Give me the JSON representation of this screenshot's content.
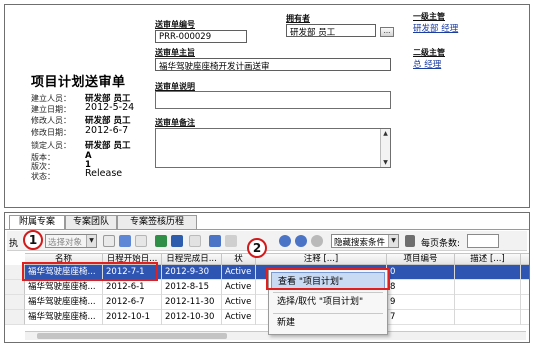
{
  "form": {
    "title": "项目计划送审单",
    "meta_rows": [
      {
        "label": "建立人员：",
        "value": "研发部 员工",
        "bold": true
      },
      {
        "label": "建立日期：",
        "value": "2012-5-24",
        "bold": false
      },
      {
        "label": "修改人员：",
        "value": "研发部 员工",
        "bold": true
      },
      {
        "label": "修改日期：",
        "value": "2012-6-7",
        "bold": false
      },
      {
        "label": "锁定人员：",
        "value": "研发部 员工",
        "bold": true
      },
      {
        "label": "版本：",
        "value": "A",
        "bold": true
      },
      {
        "label": "版次：",
        "value": "1",
        "bold": true
      },
      {
        "label": "状态：",
        "value": "Release",
        "bold": false
      }
    ],
    "number_label": "送审单编号",
    "number_value": "PRR-000029",
    "owner_label": "拥有者",
    "owner_value": "研发部 员工",
    "owner_button": "...",
    "subject_label": "送审单主旨",
    "subject_value": "福华驾驶座座椅开发计画送审",
    "description_label": "送审单说明",
    "remark_label": "送审单备注",
    "level1_label": "一级主管",
    "level1_value": "研发部 经理",
    "level2_label": "二级主管",
    "level2_value": "总 经理"
  },
  "tabs": [
    {
      "label": "附属专案",
      "active": true
    },
    {
      "label": "专案团队",
      "active": false
    },
    {
      "label": "专案签核历程",
      "active": false
    }
  ],
  "toolbar": {
    "prefix": "执",
    "select_object": "选择对象",
    "search_condition": "隐藏搜索条件",
    "per_page_label": "每页条数:"
  },
  "grid": {
    "columns": [
      "名称",
      "日程开始日...",
      "日程完成日...",
      "状",
      "注释 [...]",
      "项目编号",
      "描述 [...]"
    ],
    "rows": [
      {
        "name": "福华驾驶座座椅...",
        "start": "2012-7-1",
        "end": "2012-9-30",
        "status": "Active",
        "note": "",
        "num": "0",
        "desc": "",
        "selected": true
      },
      {
        "name": "福华驾驶座座椅...",
        "start": "2012-6-1",
        "end": "2012-8-15",
        "status": "Active",
        "note": "",
        "num": "8",
        "desc": "",
        "selected": false
      },
      {
        "name": "福华驾驶座座椅...",
        "start": "2012-6-7",
        "end": "2012-11-30",
        "status": "Active",
        "note": "",
        "num": "9",
        "desc": "",
        "selected": false
      },
      {
        "name": "福华驾驶座座椅...",
        "start": "2012-10-1",
        "end": "2012-10-30",
        "status": "Active",
        "note": "",
        "num": "7",
        "desc": "",
        "selected": false
      }
    ]
  },
  "context_menu": {
    "items": [
      "查看 \"项目计划\"",
      "选择/取代 \"项目计划\"",
      "新建"
    ]
  },
  "annotations": {
    "badge1": "1",
    "badge2": "2"
  },
  "colors": {
    "selection": "#2f55b3",
    "annotation_red": "#e01f1f",
    "link_blue": "#1b3ca0",
    "menu_highlight": "#c9daf3"
  }
}
